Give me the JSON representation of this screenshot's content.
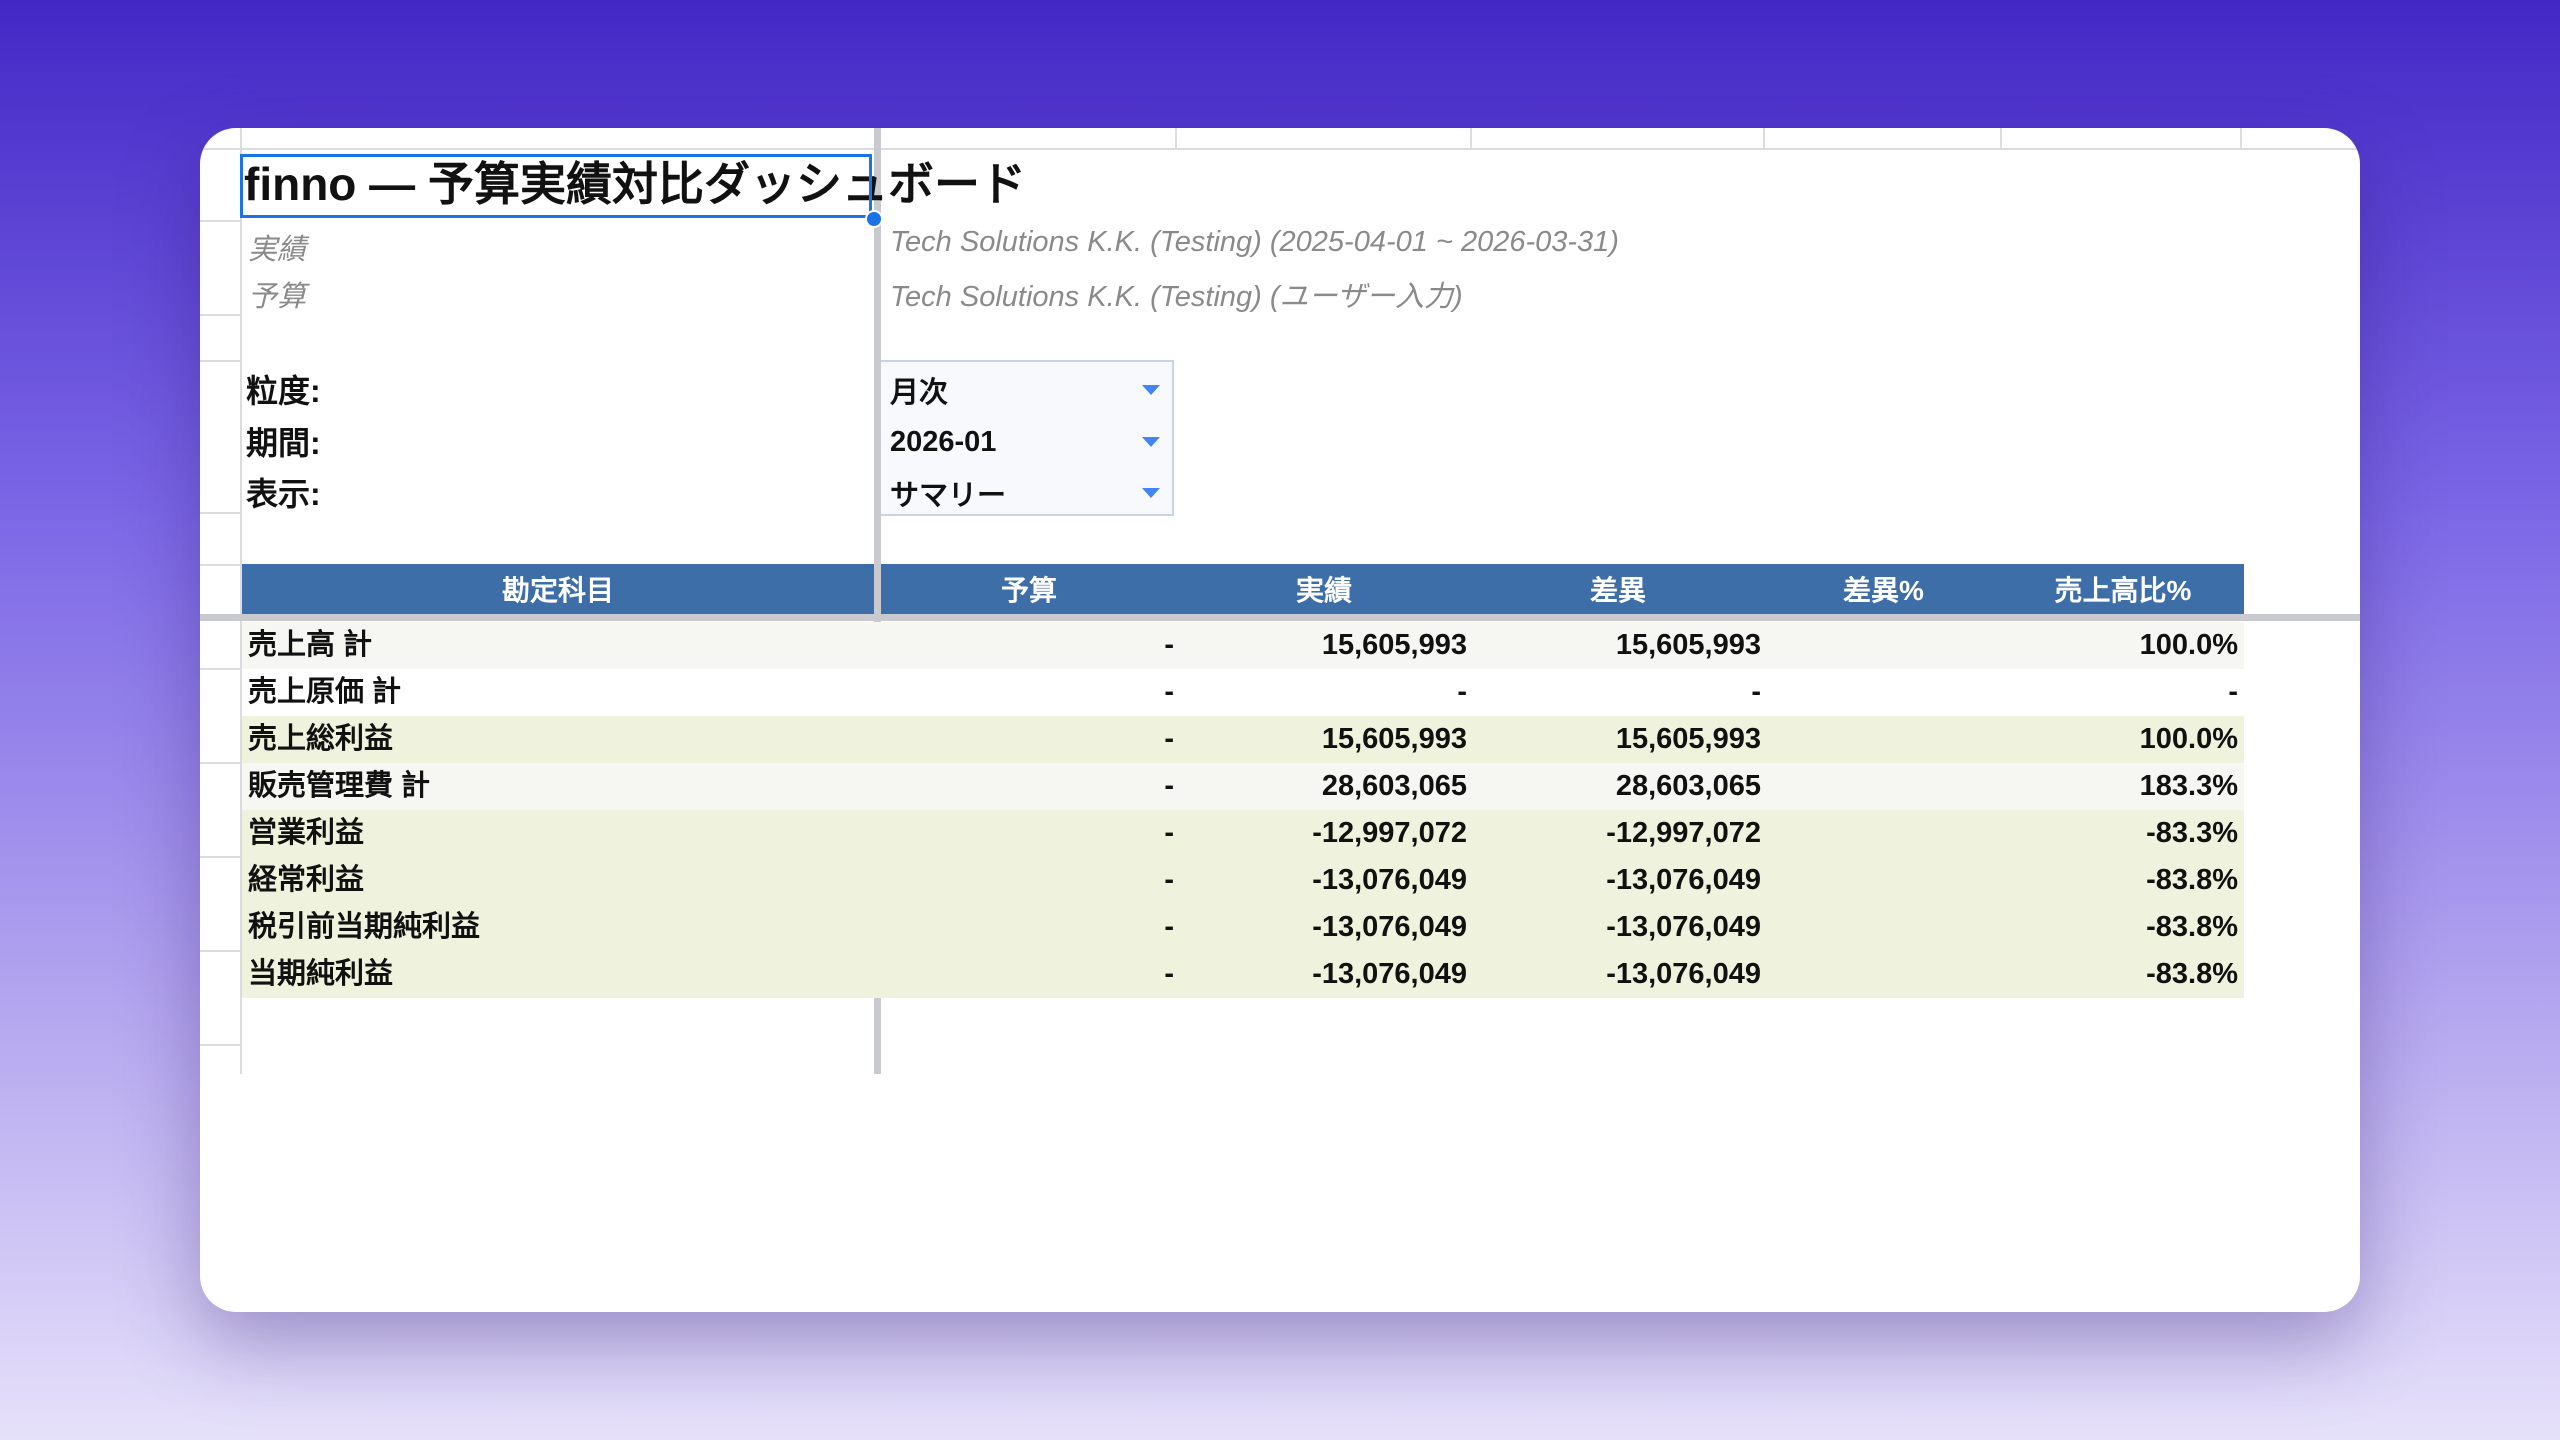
{
  "sheet": {
    "title": "finno — 予算実績対比ダッシュボード",
    "meta": [
      {
        "label": "実績",
        "value": "Tech Solutions K.K. (Testing) (2025-04-01 ~ 2026-03-31)"
      },
      {
        "label": "予算",
        "value": "Tech Solutions K.K. (Testing) (ユーザー入力)"
      }
    ],
    "controls": [
      {
        "label": "粒度:",
        "value": "月次"
      },
      {
        "label": "期間:",
        "value": "2026-01"
      },
      {
        "label": "表示:",
        "value": "サマリー"
      }
    ],
    "table": {
      "headers": [
        "勘定科目",
        "予算",
        "実績",
        "差異",
        "差異%",
        "売上高比%"
      ],
      "rows": [
        {
          "account": "売上高 計",
          "budget": "-",
          "actual": "15,605,993",
          "variance": "15,605,993",
          "variance_pct": "",
          "sales_ratio": "100.0%"
        },
        {
          "account": "売上原価 計",
          "budget": "-",
          "actual": "-",
          "variance": "-",
          "variance_pct": "",
          "sales_ratio": "-"
        },
        {
          "account": "売上総利益",
          "budget": "-",
          "actual": "15,605,993",
          "variance": "15,605,993",
          "variance_pct": "",
          "sales_ratio": "100.0%"
        },
        {
          "account": "販売管理費 計",
          "budget": "-",
          "actual": "28,603,065",
          "variance": "28,603,065",
          "variance_pct": "",
          "sales_ratio": "183.3%"
        },
        {
          "account": "営業利益",
          "budget": "-",
          "actual": "-12,997,072",
          "variance": "-12,997,072",
          "variance_pct": "",
          "sales_ratio": "-83.3%"
        },
        {
          "account": "経常利益",
          "budget": "-",
          "actual": "-13,076,049",
          "variance": "-13,076,049",
          "variance_pct": "",
          "sales_ratio": "-83.8%"
        },
        {
          "account": "税引前当期純利益",
          "budget": "-",
          "actual": "-13,076,049",
          "variance": "-13,076,049",
          "variance_pct": "",
          "sales_ratio": "-83.8%"
        },
        {
          "account": "当期純利益",
          "budget": "-",
          "actual": "-13,076,049",
          "variance": "-13,076,049",
          "variance_pct": "",
          "sales_ratio": "-83.8%"
        }
      ],
      "row_styles": [
        "gray",
        "white",
        "green",
        "gray",
        "green",
        "green",
        "green",
        "green"
      ]
    },
    "colors": {
      "header_bg": "#3d6ea8",
      "row_gray": "#f6f6f2",
      "row_green": "#eff2dd",
      "row_white": "#ffffff",
      "selection": "#1a73e8",
      "dropdown_arrow": "#4285f4"
    }
  }
}
